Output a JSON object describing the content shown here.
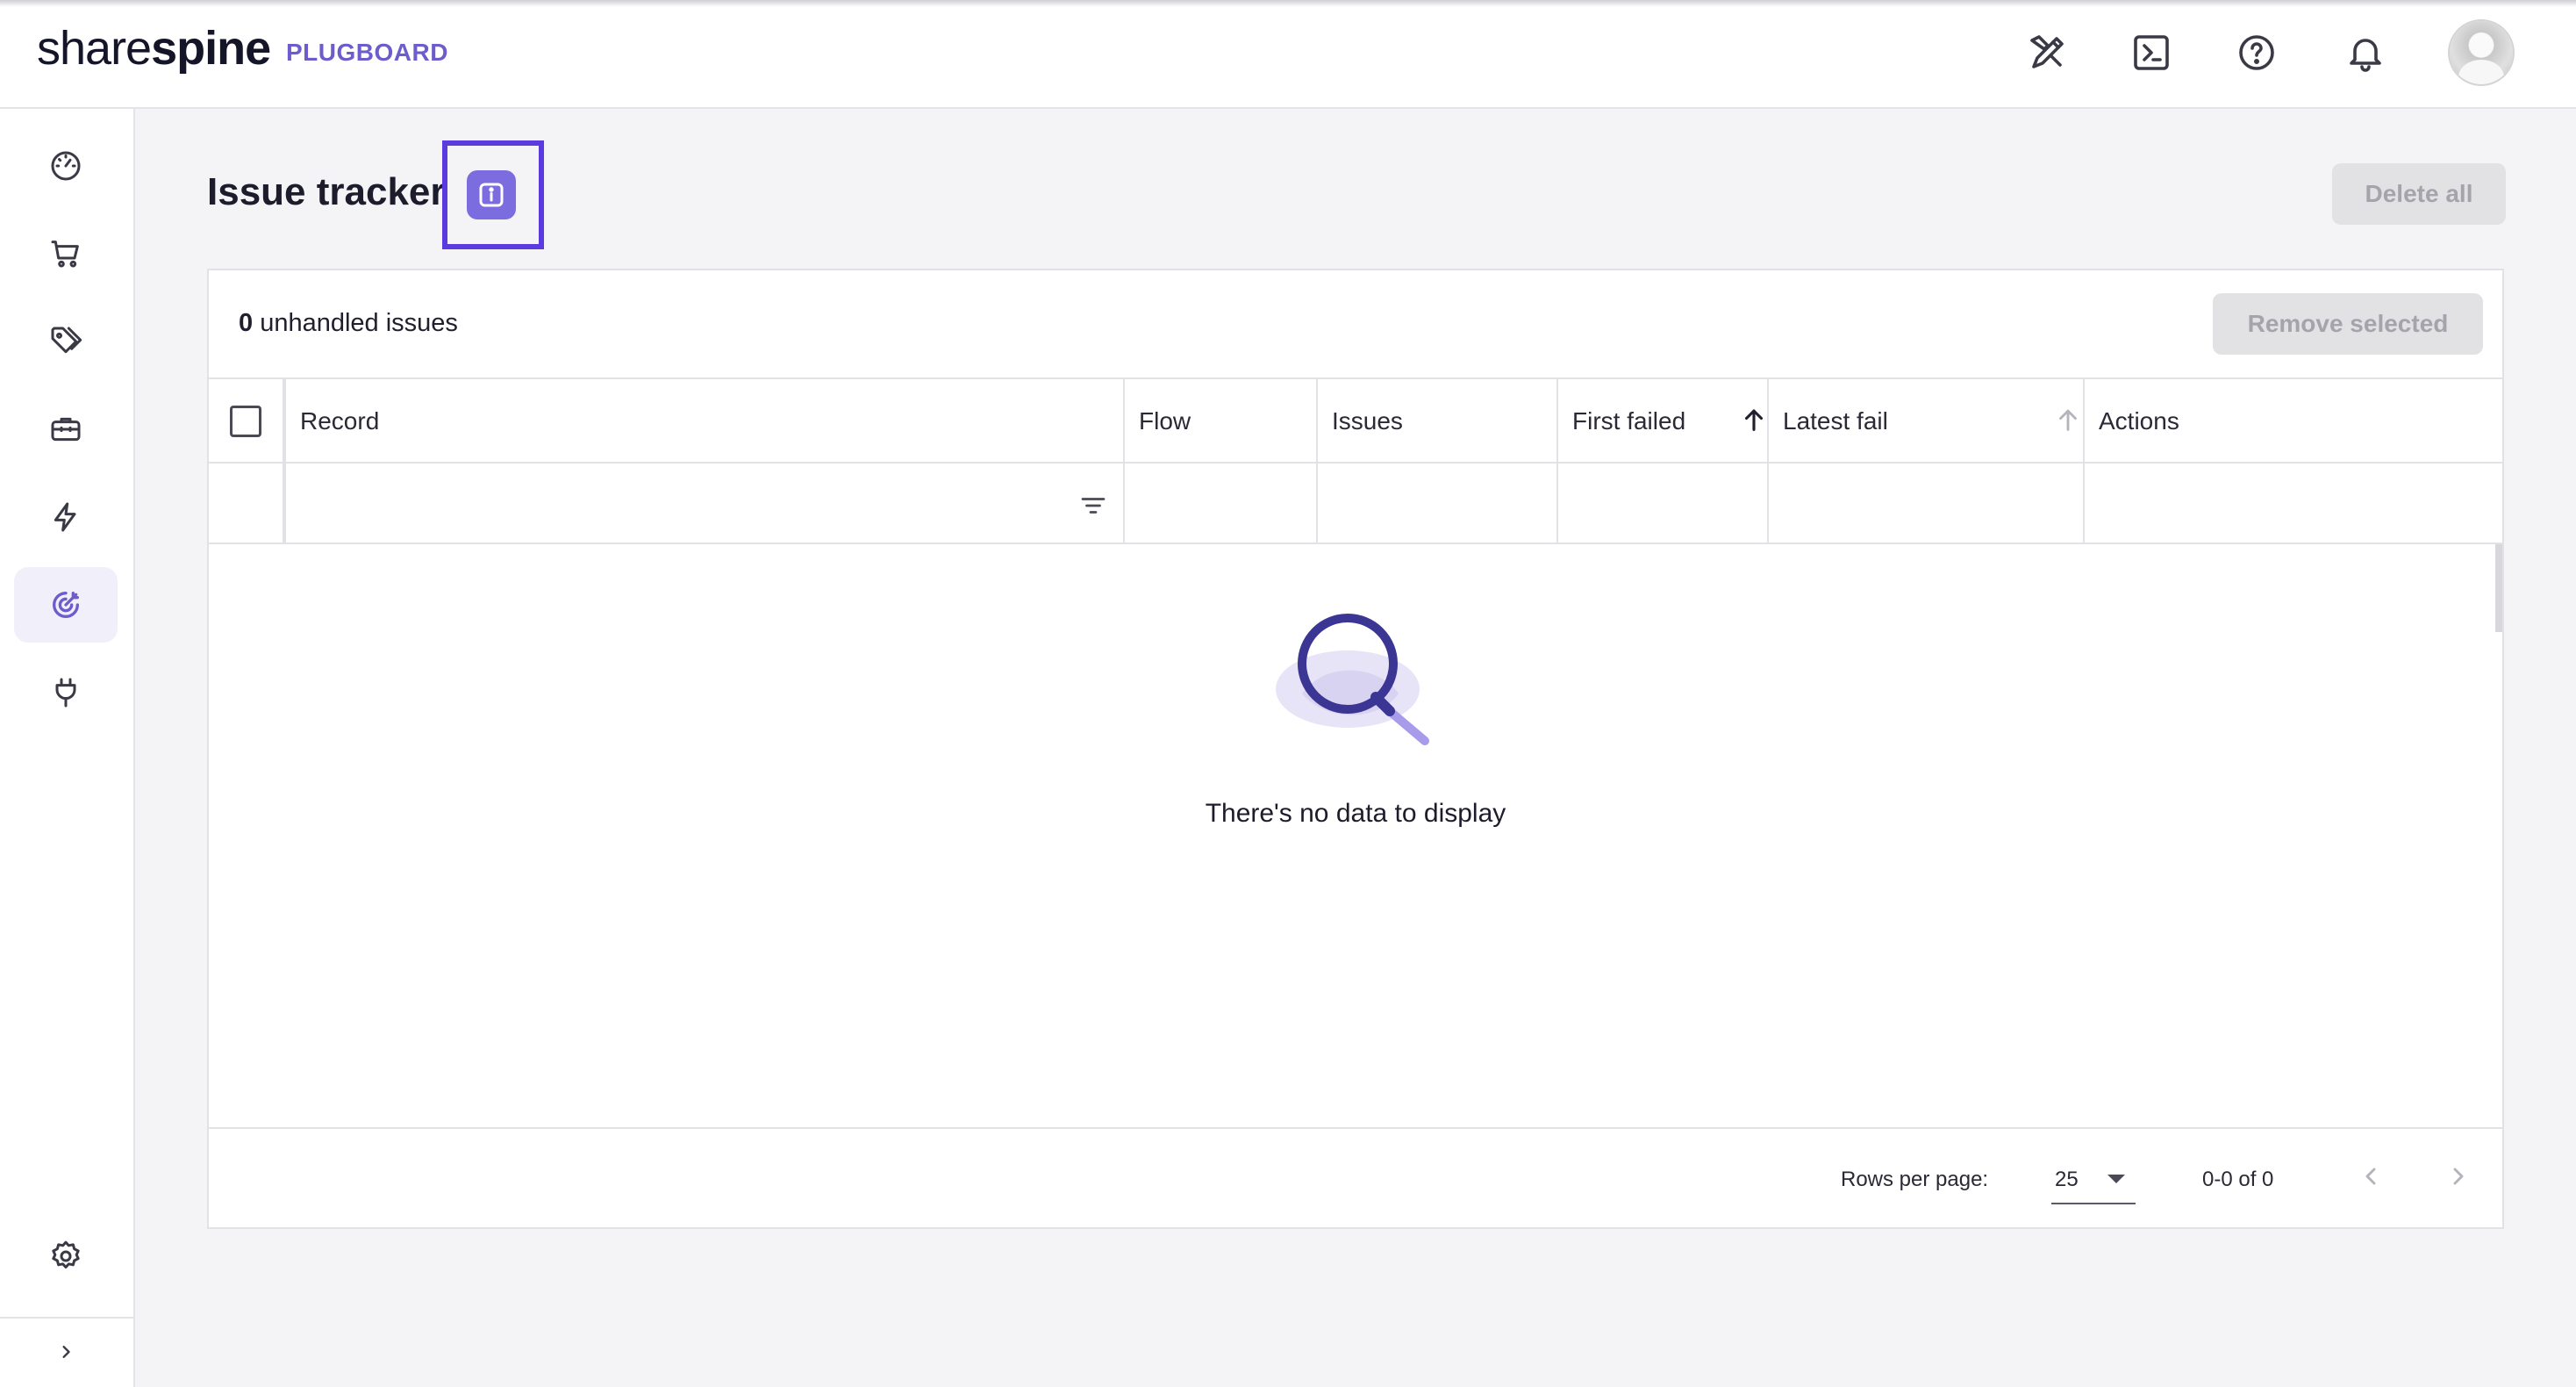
{
  "brand": {
    "name_light": "share",
    "name_bold": "spine",
    "product": "PLUGBOARD"
  },
  "topbar": {
    "icons": [
      "design-tools-icon",
      "terminal-icon",
      "help-icon",
      "notifications-icon"
    ],
    "avatar": "user-avatar"
  },
  "sidebar": {
    "items": [
      {
        "name": "dashboard",
        "icon": "dashboard-gauge-icon",
        "active": false
      },
      {
        "name": "orders",
        "icon": "shopping-cart-icon",
        "active": false
      },
      {
        "name": "products",
        "icon": "price-tags-icon",
        "active": false
      },
      {
        "name": "toolbox",
        "icon": "toolbox-icon",
        "active": false
      },
      {
        "name": "flows",
        "icon": "lightning-icon",
        "active": false
      },
      {
        "name": "issue-tracker",
        "icon": "target-icon",
        "active": true
      },
      {
        "name": "connectors",
        "icon": "plug-icon",
        "active": false
      }
    ],
    "settings_icon": "settings-gear-icon",
    "expand_icon": "chevron-right-icon"
  },
  "page": {
    "title": "Issue tracker",
    "info_icon": "info-icon",
    "delete_all_label": "Delete all"
  },
  "issues": {
    "count": "0",
    "count_suffix": "unhandled issues",
    "remove_selected_label": "Remove selected",
    "columns": [
      "Record",
      "Flow",
      "Issues",
      "First failed",
      "Latest fail",
      "Actions"
    ],
    "empty_text": "There's no data to display"
  },
  "pagination": {
    "rows_per_page_label": "Rows per page:",
    "rows_per_page_value": "25",
    "range_text": "0-0 of 0"
  },
  "colors": {
    "accent": "#6c5ccc",
    "highlight_border": "#5b3ae0",
    "info_button": "#7b6ce0",
    "disabled_button": "#e2e2e4"
  }
}
